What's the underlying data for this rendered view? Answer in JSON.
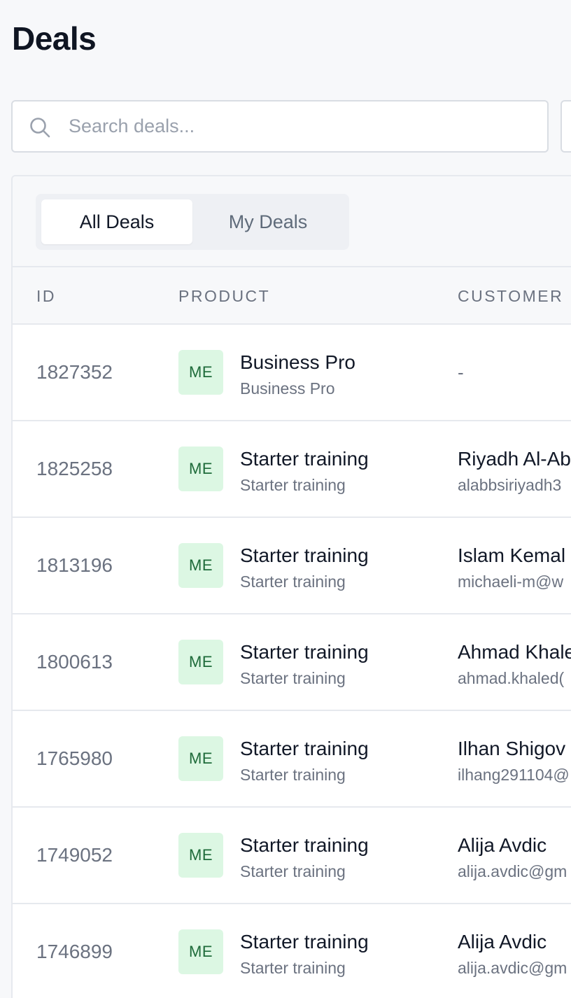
{
  "page": {
    "title": "Deals"
  },
  "search": {
    "placeholder": "Search deals...",
    "value": ""
  },
  "tabs": [
    {
      "label": "All Deals",
      "active": true
    },
    {
      "label": "My Deals",
      "active": false
    }
  ],
  "table": {
    "columns": [
      "ID",
      "PRODUCT",
      "CUSTOMER"
    ],
    "rows": [
      {
        "id": "1827352",
        "product_badge": "ME",
        "product_name": "Business Pro",
        "product_sub": "Business Pro",
        "customer_name": "-",
        "customer_email": ""
      },
      {
        "id": "1825258",
        "product_badge": "ME",
        "product_name": "Starter training",
        "product_sub": "Starter training",
        "customer_name": "Riyadh Al-Ab",
        "customer_email": "alabbsiriyadh3"
      },
      {
        "id": "1813196",
        "product_badge": "ME",
        "product_name": "Starter training",
        "product_sub": "Starter training",
        "customer_name": "Islam Kemal",
        "customer_email": "michaeli-m@w"
      },
      {
        "id": "1800613",
        "product_badge": "ME",
        "product_name": "Starter training",
        "product_sub": "Starter training",
        "customer_name": "Ahmad Khale",
        "customer_email": "ahmad.khaled("
      },
      {
        "id": "1765980",
        "product_badge": "ME",
        "product_name": "Starter training",
        "product_sub": "Starter training",
        "customer_name": "Ilhan Shigov",
        "customer_email": "ilhang291104@"
      },
      {
        "id": "1749052",
        "product_badge": "ME",
        "product_name": "Starter training",
        "product_sub": "Starter training",
        "customer_name": "Alija Avdic",
        "customer_email": "alija.avdic@gm"
      },
      {
        "id": "1746899",
        "product_badge": "ME",
        "product_name": "Starter training",
        "product_sub": "Starter training",
        "customer_name": "Alija Avdic",
        "customer_email": "alija.avdic@gm"
      }
    ]
  },
  "colors": {
    "badge_bg": "#dcf7e3",
    "badge_text": "#1e6b3a",
    "muted_text": "#6b7280",
    "border": "#e6e9ee"
  },
  "icons": {
    "search": "search-icon"
  }
}
